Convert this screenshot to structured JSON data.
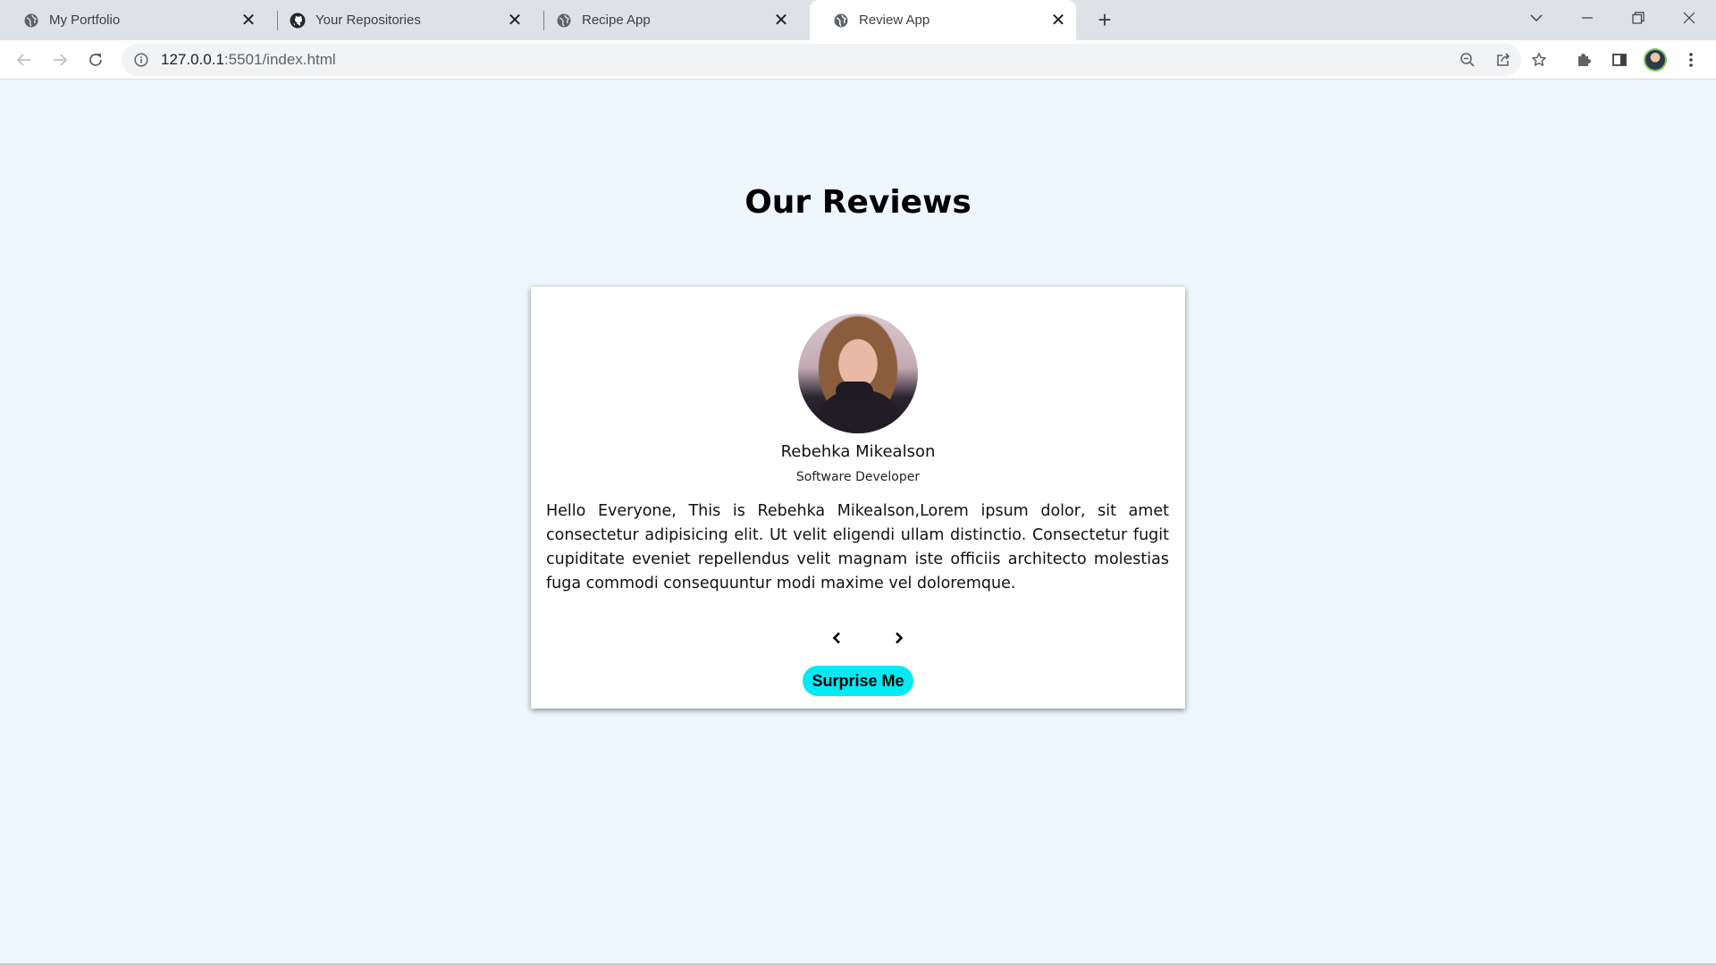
{
  "browser": {
    "tabs": [
      {
        "title": "My Portfolio",
        "icon": "globe-icon",
        "active": false
      },
      {
        "title": "Your Repositories",
        "icon": "github-icon",
        "active": false
      },
      {
        "title": "Recipe App",
        "icon": "globe-icon",
        "active": false
      },
      {
        "title": "Review App",
        "icon": "globe-icon",
        "active": true
      }
    ],
    "url_host": "127.0.0.1",
    "url_rest": ":5501/index.html"
  },
  "page": {
    "heading": "Our Reviews",
    "review": {
      "name": "Rebehka Mikealson",
      "job": "Software Developer",
      "text": "Hello Everyone, This is Rebehka Mikealson,Lorem ipsum dolor, sit amet consectetur adipisicing elit. Ut velit eligendi ullam distinctio. Consectetur fugit cupiditate eveniet repellendus velit magnam iste officiis architecto molestias fuga commodi consequuntur modi maxime vel doloremque."
    },
    "surprise_label": "Surprise Me"
  },
  "colors": {
    "page_background": "#eef6fe",
    "accent_button": "#00eaf4"
  }
}
